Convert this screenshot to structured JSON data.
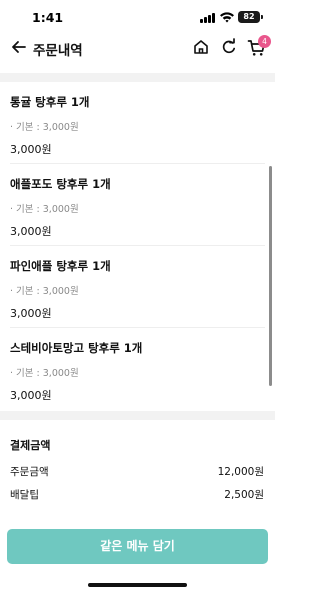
{
  "status_bar": {
    "time": "1:41",
    "battery": "82"
  },
  "header": {
    "title": "주문내역",
    "cart_count": "4"
  },
  "order_items": [
    {
      "name": "통귤 탕후루 1개",
      "option": "· 기본 : 3,000원",
      "price": "3,000원"
    },
    {
      "name": "애플포도 탕후루 1개",
      "option": "· 기본 : 3,000원",
      "price": "3,000원"
    },
    {
      "name": "파인애플 탕후루 1개",
      "option": "· 기본 : 3,000원",
      "price": "3,000원"
    },
    {
      "name": "스테비아토망고 탕후루 1개",
      "option": "· 기본 : 3,000원",
      "price": "3,000원"
    }
  ],
  "payment": {
    "title": "결제금액",
    "rows": [
      {
        "label": "주문금액",
        "value": "12,000원"
      },
      {
        "label": "배달팁",
        "value": "2,500원"
      }
    ]
  },
  "cta_label": "같은 메뉴 담기"
}
